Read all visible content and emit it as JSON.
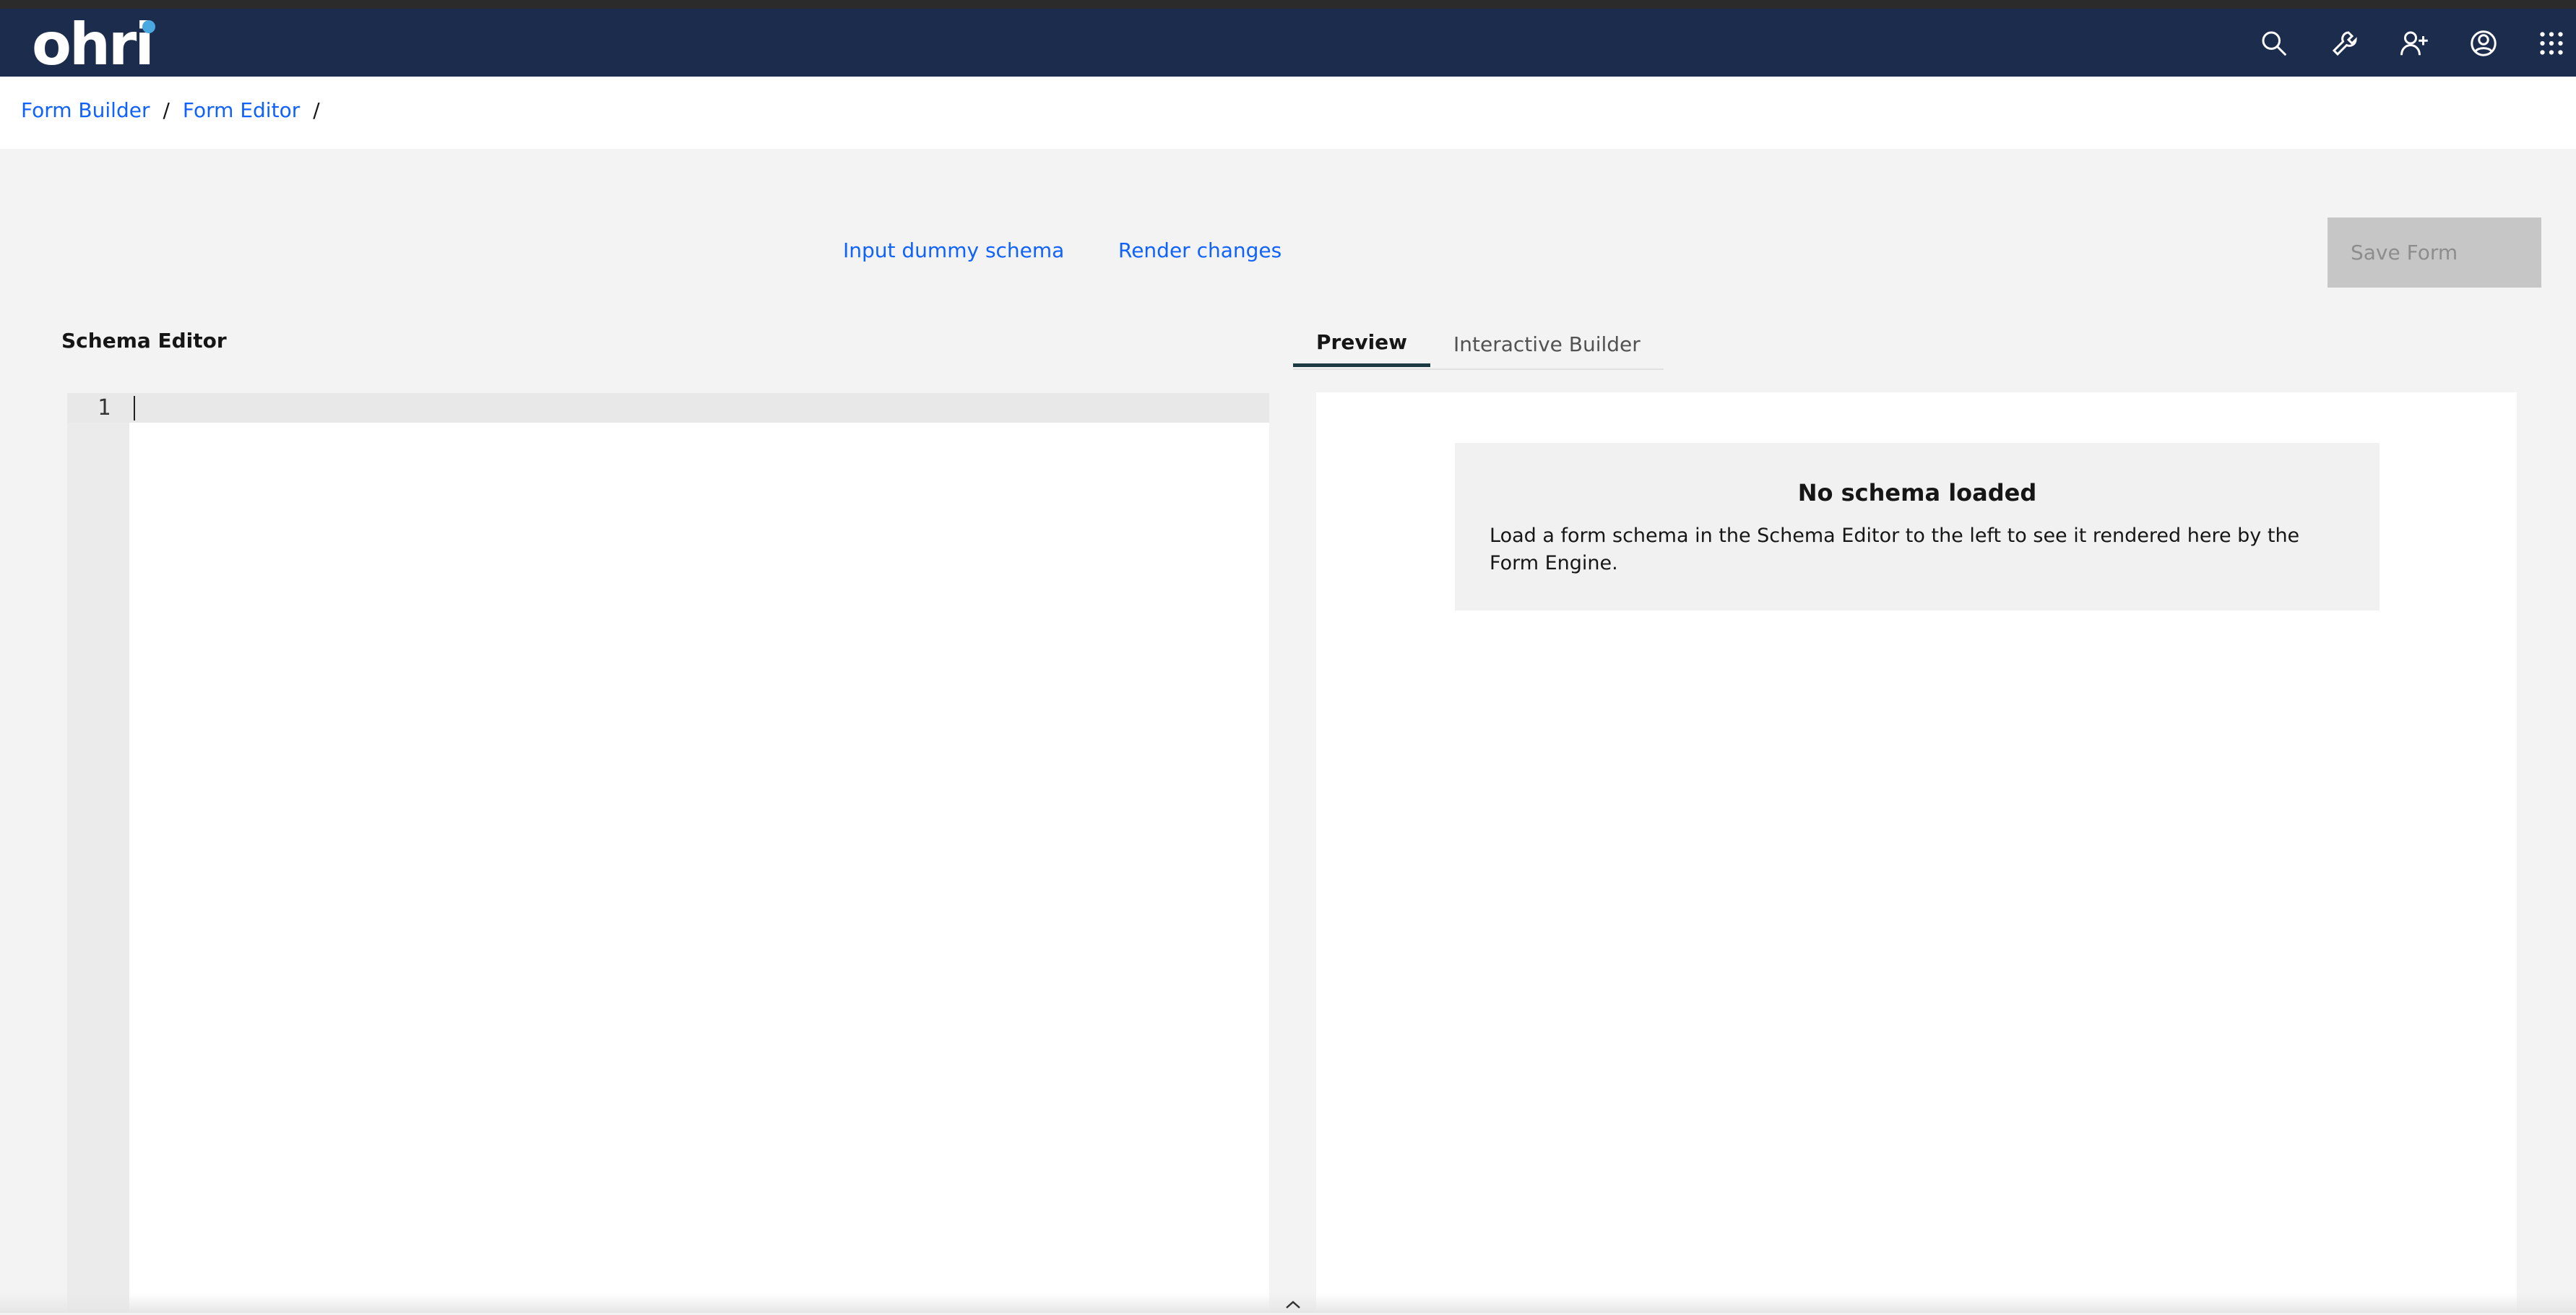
{
  "header": {
    "logo_text": "ohri",
    "icons": [
      "search-icon",
      "wrench-icon",
      "add-user-icon",
      "user-avatar-icon",
      "app-switcher-icon"
    ]
  },
  "breadcrumb": {
    "items": [
      "Form Builder",
      "Form Editor"
    ],
    "separator": "/"
  },
  "toolbar": {
    "input_dummy_label": "Input dummy schema",
    "render_changes_label": "Render changes",
    "save_label": "Save Form"
  },
  "schema_editor": {
    "title": "Schema Editor",
    "line_numbers": [
      "1"
    ]
  },
  "tabs": {
    "items": [
      "Preview",
      "Interactive Builder"
    ],
    "active": "Preview"
  },
  "preview": {
    "notice_title": "No schema loaded",
    "notice_body": "Load a form schema in the Schema Editor to the left to see it rendered here by the Form Engine."
  },
  "colors": {
    "header_bg": "#1c2c4c",
    "link": "#0f62fe",
    "logo_dot": "#4aa8e0",
    "disabled_button": "#c6c6c6"
  }
}
